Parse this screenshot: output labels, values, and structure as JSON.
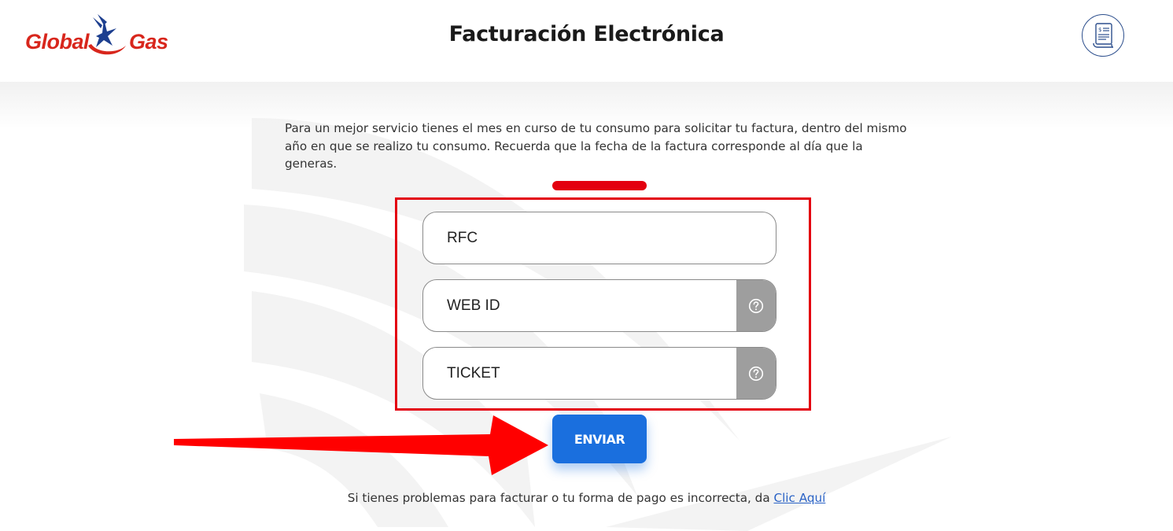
{
  "header": {
    "logo": {
      "word_left": "Global",
      "word_right": "Gas",
      "brand_red": "#d8261c",
      "brand_blue": "#1d3f8f"
    },
    "title": "Facturación Electrónica",
    "invoice_icon": "receipt-icon"
  },
  "intro": {
    "text": "Para un mejor servicio tienes el mes en curso de tu consumo para solicitar tu factura, dentro del mismo año en que se realizo tu consumo. Recuerda que la fecha de la factura corresponde al día que la generas."
  },
  "form": {
    "rfc": {
      "placeholder": "RFC",
      "value": ""
    },
    "web_id": {
      "placeholder": "WEB ID",
      "value": "",
      "help_icon": "question-circle-icon"
    },
    "ticket": {
      "placeholder": "TICKET",
      "value": "",
      "help_icon": "question-circle-icon"
    },
    "submit_label": "ENVIAR"
  },
  "annotation": {
    "color": "#e3000f"
  },
  "footer": {
    "text": "Si tienes problemas para facturar o tu forma de pago es incorrecta, da",
    "link_label": "Clic Aquí"
  },
  "colors": {
    "accent": "#1a6fde",
    "help_bg": "#9e9e9e"
  }
}
